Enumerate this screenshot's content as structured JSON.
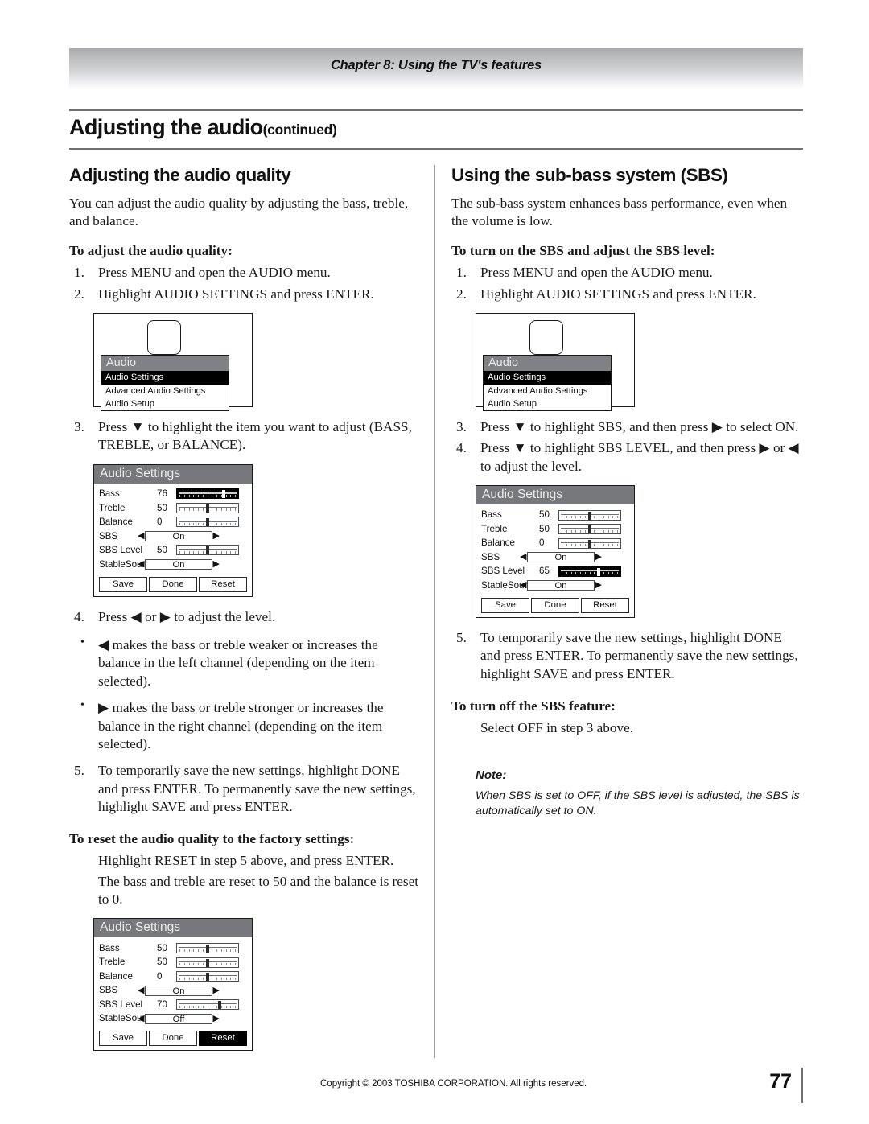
{
  "header": {
    "chapter": "Chapter 8: Using the TV's features",
    "title_main": "Adjusting the audio",
    "title_cont": "(continued)"
  },
  "footer": {
    "copyright": "Copyright © 2003 TOSHIBA CORPORATION. All rights reserved.",
    "page_number": "77"
  },
  "left_column": {
    "section_title": "Adjusting the audio quality",
    "intro": "You can adjust the audio quality by adjusting the bass, treble, and balance.",
    "sub1": "To adjust the audio quality:",
    "step1_num": "1.",
    "step1": "Press MENU and open the AUDIO menu.",
    "step2_num": "2.",
    "step2": "Highlight AUDIO SETTINGS and press ENTER.",
    "step3_num": "3.",
    "step3": "Press ▼ to highlight the item you want to adjust (BASS, TREBLE, or BALANCE).",
    "step4_num": "4.",
    "step4": "Press ◀ or ▶ to adjust the level.",
    "bullet1_mark": "•",
    "bullet1": "◀ makes the bass or treble weaker or increases the balance in the left channel (depending on the item selected).",
    "bullet2_mark": "•",
    "bullet2": "▶ makes the bass or treble stronger or increases the balance in the right channel (depending on the item selected).",
    "step5_num": "5.",
    "step5": "To temporarily save the new settings, highlight DONE and press ENTER. To permanently save the new settings, highlight SAVE and press ENTER.",
    "sub2": "To reset the audio quality to the factory settings:",
    "reset_line1": "Highlight RESET in step 5 above, and press ENTER.",
    "reset_line2": "The bass and treble are reset to 50 and the balance is reset to 0."
  },
  "right_column": {
    "section_title": "Using the sub-bass system (SBS)",
    "intro": "The sub-bass system enhances bass performance, even when the volume is low.",
    "sub1": "To turn on the SBS and adjust the SBS level:",
    "step1_num": "1.",
    "step1": "Press MENU and open the AUDIO menu.",
    "step2_num": "2.",
    "step2": "Highlight AUDIO SETTINGS and press ENTER.",
    "step3_num": "3.",
    "step3": "Press ▼ to highlight SBS, and then press ▶ to select ON.",
    "step4_num": "4.",
    "step4": "Press ▼ to highlight SBS LEVEL, and then press ▶ or ◀ to adjust the level.",
    "step5_num": "5.",
    "step5": "To temporarily save the new settings, highlight DONE and press ENTER. To permanently save the new settings, highlight SAVE and press ENTER.",
    "sub2": "To turn off the SBS feature:",
    "off_line": "Select OFF in step 3 above.",
    "note_label": "Note:",
    "note_text": "When SBS is set to OFF, if the SBS level is adjusted, the SBS is automatically set to ON."
  },
  "osd": {
    "audio_menu": {
      "title": "Audio",
      "items": [
        {
          "label": "Audio Settings",
          "selected": true
        },
        {
          "label": "Advanced Audio Settings",
          "selected": false
        },
        {
          "label": "Audio Setup",
          "selected": false
        }
      ]
    },
    "audio_settings_title": "Audio Settings",
    "buttons": {
      "save": "Save",
      "done": "Done",
      "reset": "Reset"
    },
    "panel_left_1": {
      "rows": [
        {
          "label": "Bass",
          "value": "76",
          "type": "slider",
          "pos": 76,
          "highlight": true
        },
        {
          "label": "Treble",
          "value": "50",
          "type": "slider",
          "pos": 50,
          "highlight": false
        },
        {
          "label": "Balance",
          "value": "0",
          "type": "slider",
          "pos": 50,
          "highlight": false
        },
        {
          "label": "SBS",
          "value": "On",
          "type": "onoff",
          "highlight": false
        },
        {
          "label": "SBS Level",
          "value": "50",
          "type": "slider",
          "pos": 50,
          "highlight": false
        },
        {
          "label": "StableSound",
          "value": "On",
          "type": "onoff",
          "highlight": false
        }
      ],
      "selected_button": ""
    },
    "panel_left_2": {
      "rows": [
        {
          "label": "Bass",
          "value": "50",
          "type": "slider",
          "pos": 50,
          "highlight": false
        },
        {
          "label": "Treble",
          "value": "50",
          "type": "slider",
          "pos": 50,
          "highlight": false
        },
        {
          "label": "Balance",
          "value": "0",
          "type": "slider",
          "pos": 50,
          "highlight": false
        },
        {
          "label": "SBS",
          "value": "On",
          "type": "onoff",
          "highlight": false
        },
        {
          "label": "SBS Level",
          "value": "70",
          "type": "slider",
          "pos": 70,
          "highlight": false
        },
        {
          "label": "StableSound",
          "value": "Off",
          "type": "onoff",
          "highlight": false
        }
      ],
      "selected_button": "reset"
    },
    "panel_right_1": {
      "rows": [
        {
          "label": "Bass",
          "value": "50",
          "type": "slider",
          "pos": 50,
          "highlight": false
        },
        {
          "label": "Treble",
          "value": "50",
          "type": "slider",
          "pos": 50,
          "highlight": false
        },
        {
          "label": "Balance",
          "value": "0",
          "type": "slider",
          "pos": 50,
          "highlight": false
        },
        {
          "label": "SBS",
          "value": "On",
          "type": "onoff",
          "highlight": false
        },
        {
          "label": "SBS Level",
          "value": "65",
          "type": "slider",
          "pos": 65,
          "highlight": true
        },
        {
          "label": "StableSound",
          "value": "On",
          "type": "onoff",
          "highlight": false
        }
      ],
      "selected_button": ""
    }
  },
  "colors": {
    "osd_title_gray": "#77787b",
    "osd_menu_gray": "#808184",
    "rule_gray": "#6f7073",
    "selected_black": "#000000"
  }
}
